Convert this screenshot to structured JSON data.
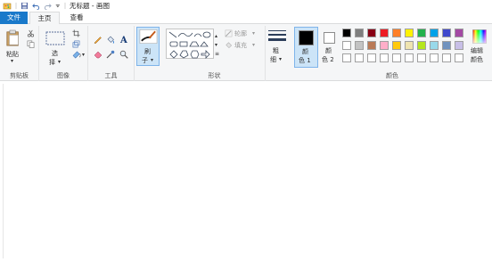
{
  "window": {
    "title": "无标题 - 画图"
  },
  "tabs": {
    "file": "文件",
    "home": "主页",
    "view": "查看"
  },
  "clipboard": {
    "paste": "粘贴",
    "group": "剪贴板"
  },
  "image": {
    "select": "选",
    "select2": "择",
    "group": "图像"
  },
  "tools": {
    "group": "工具"
  },
  "brushes": {
    "label1": "刷",
    "label2": "子"
  },
  "shapes": {
    "outline": "轮廓",
    "fill": "填充",
    "group": "形状"
  },
  "size": {
    "label1": "粗",
    "label2": "细"
  },
  "colors": {
    "color1_a": "颜",
    "color1_b": "色 1",
    "color2_a": "颜",
    "color2_b": "色 2",
    "edit_a": "编辑",
    "edit_b": "颜色",
    "group": "颜色",
    "palette_row1": [
      "#000000",
      "#7f7f7f",
      "#880015",
      "#ed1c24",
      "#ff7f27",
      "#fff200",
      "#22b14c",
      "#00a2e8",
      "#3f48cc",
      "#a349a4"
    ],
    "palette_row2": [
      "#ffffff",
      "#c3c3c3",
      "#b97a57",
      "#ffaec9",
      "#ffc90e",
      "#efe4b0",
      "#b5e61d",
      "#99d9ea",
      "#7092be",
      "#c8bfe7"
    ],
    "palette_row3": [
      "#ffffff",
      "#ffffff",
      "#ffffff",
      "#ffffff",
      "#ffffff",
      "#ffffff",
      "#ffffff",
      "#ffffff",
      "#ffffff",
      "#ffffff"
    ],
    "color1_value": "#000000",
    "color2_value": "#ffffff"
  }
}
